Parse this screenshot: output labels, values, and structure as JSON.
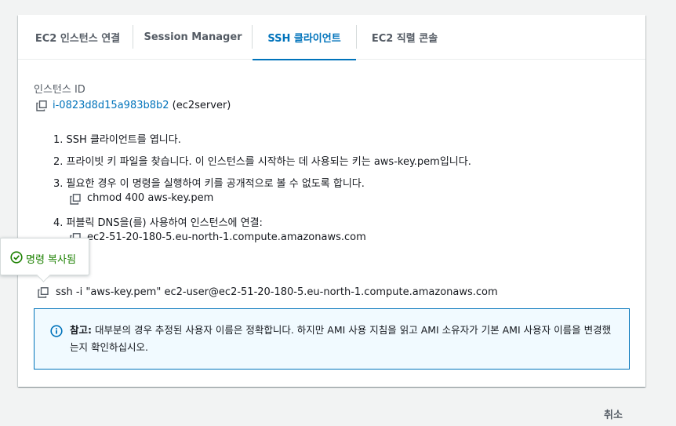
{
  "tabs": [
    {
      "label": "EC2 인스턴스 연결",
      "active": false
    },
    {
      "label": "Session Manager",
      "active": false
    },
    {
      "label": "SSH 클라이언트",
      "active": true
    },
    {
      "label": "EC2 직렬 콘솔",
      "active": false
    }
  ],
  "instance": {
    "label": "인스턴스 ID",
    "id": "i-0823d8d15a983b8b2",
    "name": "(ec2server)"
  },
  "steps": [
    "1. SSH 클라이언트를 엽니다.",
    "2. 프라이빗 키 파일을 찾습니다. 이 인스턴스를 시작하는 데 사용되는 키는 aws-key.pem입니다.",
    "3. 필요한 경우 이 명령을 실행하여 키를 공개적으로 볼 수 없도록 합니다.",
    "4. 퍼블릭 DNS을(를) 사용하여 인스턴스에 연결:"
  ],
  "chmod_command": "chmod 400 aws-key.pem",
  "public_dns": "ec2-51-20-180-5.eu-north-1.compute.amazonaws.com",
  "ssh_command": "ssh -i \"aws-key.pem\" ec2-user@ec2-51-20-180-5.eu-north-1.compute.amazonaws.com",
  "popover": {
    "text": "명령 복사됨"
  },
  "alert": {
    "title": "참고:",
    "body": "대부분의 경우 추정된 사용자 이름은 정확합니다. 하지만 AMI 사용 지침을 읽고 AMI 소유자가 기본 AMI 사용자 이름을 변경했는지 확인하십시오."
  },
  "cancel_label": "취소",
  "colors": {
    "accent": "#0073bb",
    "success": "#1d8102",
    "info_bg": "#f1faff"
  },
  "icons": {
    "copy": "copy-icon",
    "info": "info-icon",
    "success": "check-circle-icon"
  }
}
